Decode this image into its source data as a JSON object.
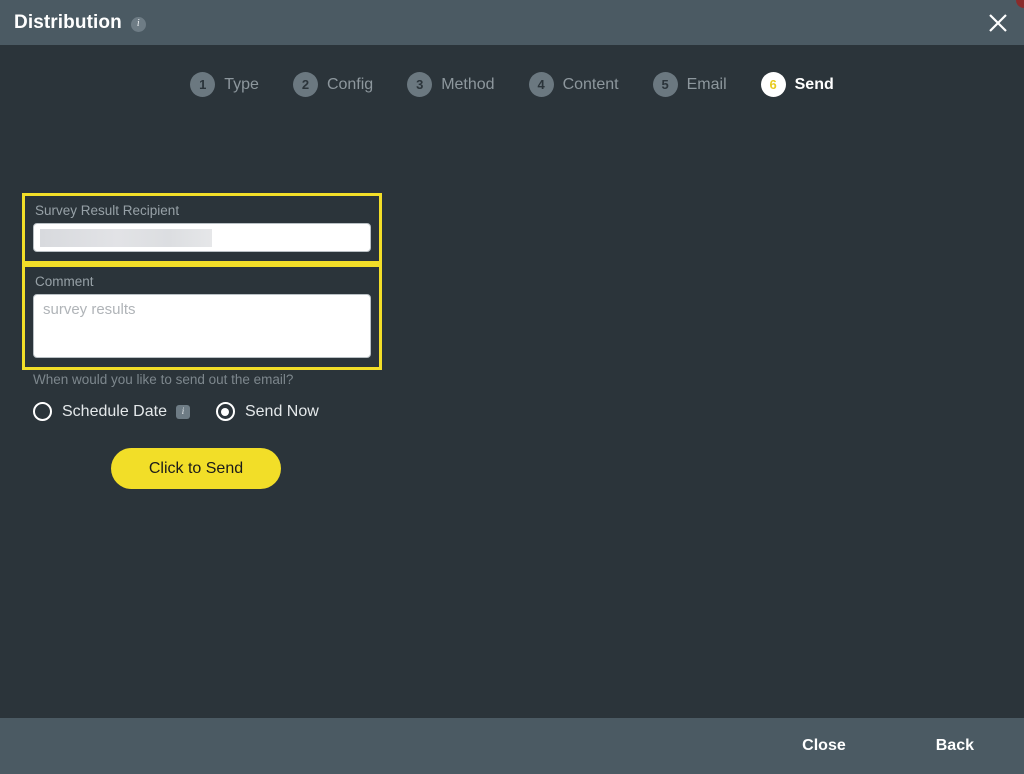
{
  "window": {
    "title": "Distribution",
    "title_info_icon": "info-icon",
    "close_icon": "close-icon"
  },
  "steps": [
    {
      "number": "1",
      "label": "Type",
      "active": false
    },
    {
      "number": "2",
      "label": "Config",
      "active": false
    },
    {
      "number": "3",
      "label": "Method",
      "active": false
    },
    {
      "number": "4",
      "label": "Content",
      "active": false
    },
    {
      "number": "5",
      "label": "Email",
      "active": false
    },
    {
      "number": "6",
      "label": "Send",
      "active": true
    }
  ],
  "form": {
    "recipient": {
      "label": "Survey Result Recipient",
      "value": "",
      "placeholder": "",
      "redacted": true
    },
    "comment": {
      "label": "Comment",
      "value": "",
      "placeholder": "survey results"
    },
    "schedule_question": "When would you like to send out the email?",
    "options": [
      {
        "label": "Schedule Date",
        "selected": false,
        "info_icon": "info-icon"
      },
      {
        "label": "Send Now",
        "selected": true
      }
    ],
    "submit_label": "Click to Send"
  },
  "footer": {
    "close_label": "Close",
    "back_label": "Back"
  },
  "colors": {
    "accent_yellow": "#f2de28",
    "chrome": "#4b5a63",
    "body": "#2b343a",
    "muted_text": "#8d979d"
  }
}
